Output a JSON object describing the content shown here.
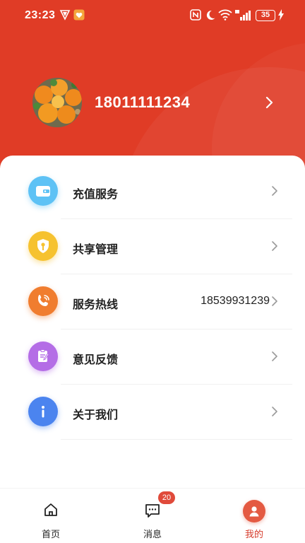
{
  "status_bar": {
    "time": "23:23",
    "battery": "35"
  },
  "profile": {
    "phone": "18011111234"
  },
  "menu": [
    {
      "label": "充值服务",
      "value": "",
      "icon": "wallet-icon",
      "color": "#5ec2f5"
    },
    {
      "label": "共享管理",
      "value": "",
      "icon": "shield-key-icon",
      "color": "#f6c22f"
    },
    {
      "label": "服务热线",
      "value": "18539931239",
      "icon": "phone-icon",
      "color": "#f07d2f"
    },
    {
      "label": "意见反馈",
      "value": "",
      "icon": "feedback-clipboard-icon",
      "color": "#b46de6"
    },
    {
      "label": "关于我们",
      "value": "",
      "icon": "info-icon",
      "color": "#4b84ef"
    }
  ],
  "tabs": [
    {
      "label": "首页",
      "icon": "home-icon"
    },
    {
      "label": "消息",
      "icon": "message-icon",
      "badge": "20"
    },
    {
      "label": "我的",
      "icon": "user-icon",
      "active": true
    }
  ],
  "colors": {
    "brand": "#e03c26",
    "active_tab": "#d63b2b"
  }
}
